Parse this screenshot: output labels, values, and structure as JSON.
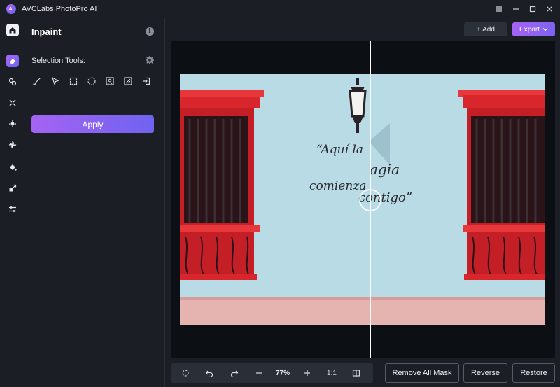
{
  "app": {
    "title": "AVCLabs PhotoPro AI"
  },
  "panel": {
    "title": "Inpaint",
    "selection_label": "Selection Tools:",
    "apply_label": "Apply"
  },
  "toolbar": {
    "add_label": "+ Add",
    "export_label": "Export"
  },
  "canvas": {
    "image_text_left_1": "“Aquí la",
    "image_text_right_1": "agia",
    "image_text_left_2": "comienza",
    "image_text_right_2": "contigo”"
  },
  "bottom": {
    "zoom": "77%",
    "ratio": "1:1",
    "remove_all_mask": "Remove All Mask",
    "reverse": "Reverse",
    "restore": "Restore"
  },
  "colors": {
    "accent_start": "#a563f3",
    "accent_end": "#6f63f0",
    "background": "#1b1e25",
    "canvas_bg": "#0c0f14"
  }
}
